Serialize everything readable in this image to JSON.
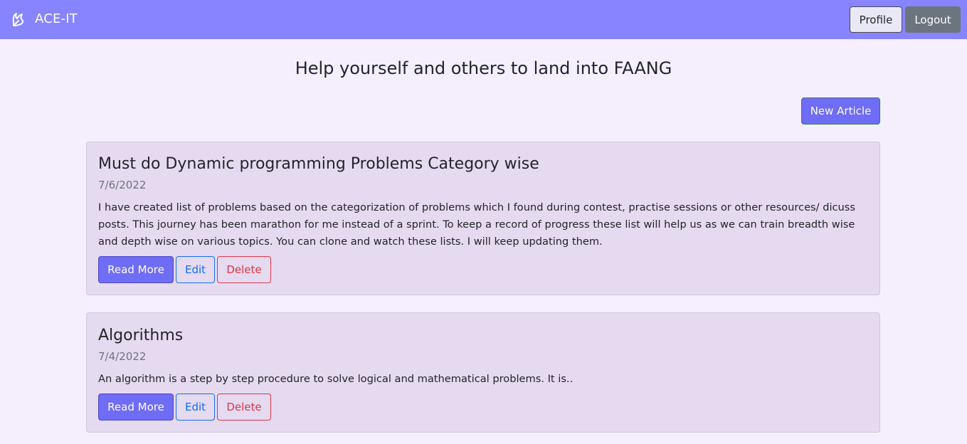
{
  "navbar": {
    "brand_label": "ACE-IT",
    "brand_icon": "feather-icon",
    "profile_label": "Profile",
    "logout_label": "Logout"
  },
  "main": {
    "title": "Help yourself and others to land into FAANG",
    "new_article_label": "New Article"
  },
  "articles": [
    {
      "title": "Must do Dynamic programming Problems Category wise",
      "date": "7/6/2022",
      "excerpt": "I have created list of problems based on the categorization of problems which I found during contest, practise sessions or other resources/ dicuss posts. This journey has been marathon for me instead of a sprint. To keep a record of progress these list will help us as we can train breadth wise and depth wise on various topics. You can clone and watch these lists. I will keep updating them.",
      "read_more_label": "Read More",
      "edit_label": "Edit",
      "delete_label": "Delete"
    },
    {
      "title": "Algorithms",
      "date": "7/4/2022",
      "excerpt": "An algorithm is a step by step procedure to solve logical and mathematical problems. It is..",
      "read_more_label": "Read More",
      "edit_label": "Edit",
      "delete_label": "Delete"
    }
  ],
  "colors": {
    "navbar_bg": "#8884ff",
    "page_bg": "#f5effd",
    "card_bg": "#e6daf0",
    "primary_button": "#6f6cf6",
    "logout_button": "#6c757d",
    "edit_outline": "#0d6efd",
    "delete_outline": "#dc3545"
  }
}
